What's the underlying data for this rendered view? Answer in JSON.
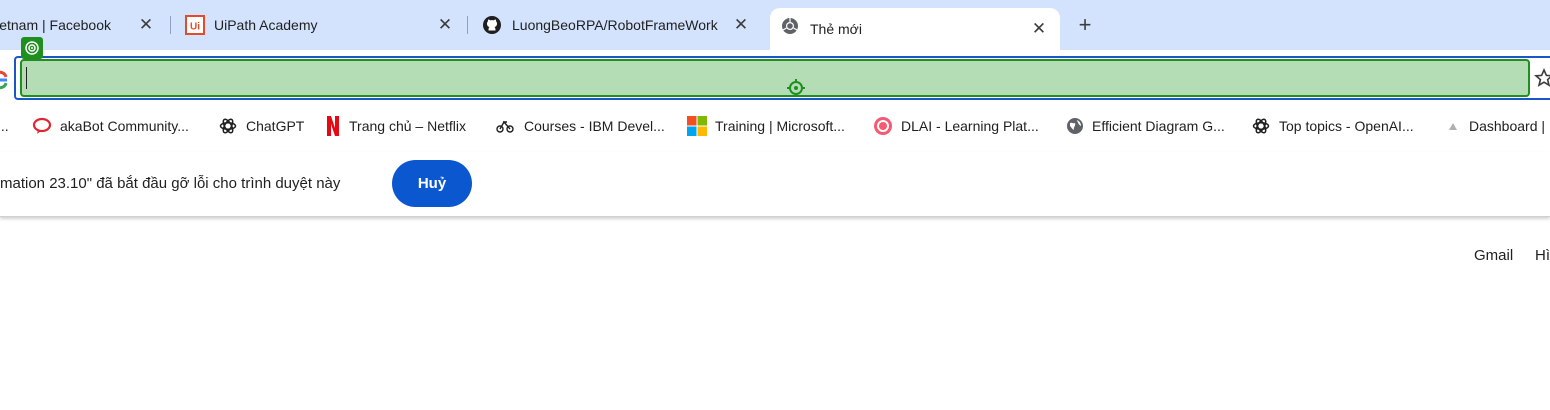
{
  "tabs": [
    {
      "title": "Vietnam | Facebook",
      "icon": "facebook-icon"
    },
    {
      "title": "UiPath Academy",
      "icon": "uipath-icon"
    },
    {
      "title": "LuongBeoRPA/RobotFrameWork",
      "icon": "github-icon"
    },
    {
      "title": "Thẻ mới",
      "icon": "chrome-icon",
      "active": true
    }
  ],
  "new_tab_symbol": "+",
  "close_symbol": "✕",
  "bookmarks": [
    {
      "label": "...",
      "icon": "bookmark-icon"
    },
    {
      "label": "akaBot Community...",
      "icon": "akabot-icon"
    },
    {
      "label": "ChatGPT",
      "icon": "openai-icon"
    },
    {
      "label": "Trang chủ – Netflix",
      "icon": "netflix-icon"
    },
    {
      "label": "Courses - IBM Devel...",
      "icon": "ibm-icon"
    },
    {
      "label": "Training | Microsoft...",
      "icon": "microsoft-icon"
    },
    {
      "label": "DLAI - Learning Plat...",
      "icon": "dlai-icon"
    },
    {
      "label": "Efficient Diagram G...",
      "icon": "globe-icon"
    },
    {
      "label": "Top topics - OpenAI...",
      "icon": "openai-icon"
    },
    {
      "label": "Dashboard |",
      "icon": "dashboard-icon"
    }
  ],
  "infobar": {
    "message": "mation 23.10\" đã bắt đầu gỡ lỗi cho trình duyệt này",
    "cancel_label": "Huỷ"
  },
  "page": {
    "gmail_label": "Gmail",
    "images_label": "Hì"
  },
  "colors": {
    "tabstrip": "#d3e3fd",
    "omnibox_highlight": "#b5ddb5",
    "highlight_border": "#1f8f1f",
    "focus_ring": "#1a57c6",
    "cancel_button": "#0b57d0"
  }
}
